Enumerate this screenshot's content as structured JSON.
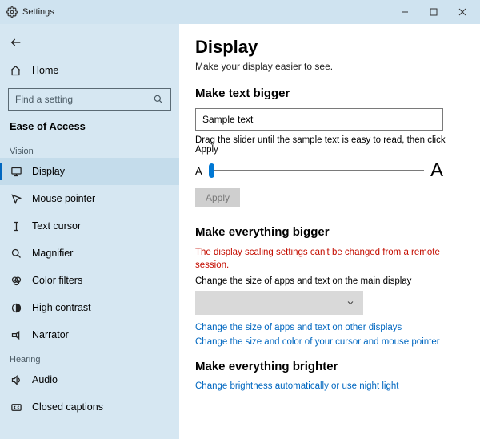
{
  "titlebar": {
    "title": "Settings"
  },
  "sidebar": {
    "home_label": "Home",
    "search_placeholder": "Find a setting",
    "category": "Ease of Access",
    "groups": [
      {
        "label": "Vision",
        "items": [
          {
            "label": "Display",
            "icon": "monitor",
            "selected": true
          },
          {
            "label": "Mouse pointer",
            "icon": "pointer"
          },
          {
            "label": "Text cursor",
            "icon": "text-cursor"
          },
          {
            "label": "Magnifier",
            "icon": "magnifier"
          },
          {
            "label": "Color filters",
            "icon": "color-filters"
          },
          {
            "label": "High contrast",
            "icon": "high-contrast"
          },
          {
            "label": "Narrator",
            "icon": "narrator"
          }
        ]
      },
      {
        "label": "Hearing",
        "items": [
          {
            "label": "Audio",
            "icon": "audio"
          },
          {
            "label": "Closed captions",
            "icon": "closed-captions"
          }
        ]
      }
    ]
  },
  "page": {
    "title": "Display",
    "subtitle": "Make your display easier to see.",
    "text_bigger": {
      "heading": "Make text bigger",
      "sample": "Sample text",
      "instruction": "Drag the slider until the sample text is easy to read, then click Apply",
      "small_a": "A",
      "big_a": "A",
      "apply_label": "Apply"
    },
    "everything_bigger": {
      "heading": "Make everything bigger",
      "warning": "The display scaling settings can't be changed from a remote session.",
      "desc": "Change the size of apps and text on the main display",
      "link_other_displays": "Change the size of apps and text on other displays",
      "link_cursor": "Change the size and color of your cursor and mouse pointer"
    },
    "brighter": {
      "heading": "Make everything brighter",
      "link_brightness": "Change brightness automatically or use night light"
    }
  }
}
